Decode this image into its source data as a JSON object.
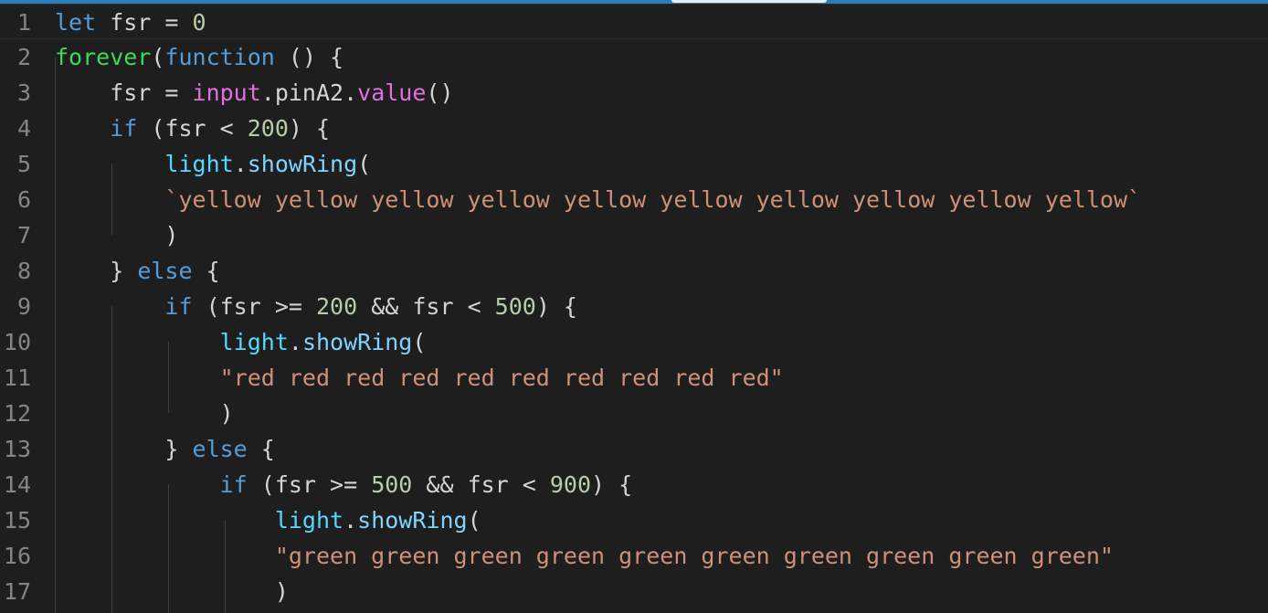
{
  "lines": [
    {
      "num": "1",
      "tokens": [
        {
          "t": "let",
          "c": "kw"
        },
        {
          "t": " fsr = ",
          "c": ""
        },
        {
          "t": "0",
          "c": "num"
        }
      ]
    },
    {
      "num": "2",
      "tokens": [
        {
          "t": "forever",
          "c": "green-fn"
        },
        {
          "t": "(",
          "c": ""
        },
        {
          "t": "function",
          "c": "kw"
        },
        {
          "t": " () {",
          "c": ""
        }
      ]
    },
    {
      "num": "3",
      "tokens": [
        {
          "t": "    fsr = ",
          "c": ""
        },
        {
          "t": "input",
          "c": "input-kw"
        },
        {
          "t": ".pinA2.",
          "c": ""
        },
        {
          "t": "value",
          "c": "input-kw"
        },
        {
          "t": "()",
          "c": ""
        }
      ]
    },
    {
      "num": "4",
      "tokens": [
        {
          "t": "    ",
          "c": ""
        },
        {
          "t": "if",
          "c": "kw"
        },
        {
          "t": " (fsr < ",
          "c": ""
        },
        {
          "t": "200",
          "c": "num"
        },
        {
          "t": ") {",
          "c": ""
        }
      ]
    },
    {
      "num": "5",
      "tokens": [
        {
          "t": "        ",
          "c": ""
        },
        {
          "t": "light",
          "c": "light-obj"
        },
        {
          "t": ".",
          "c": ""
        },
        {
          "t": "showRing",
          "c": "method"
        },
        {
          "t": "(",
          "c": ""
        }
      ]
    },
    {
      "num": "6",
      "tokens": [
        {
          "t": "        ",
          "c": ""
        },
        {
          "t": "`yellow yellow yellow yellow yellow yellow yellow yellow yellow yellow`",
          "c": "str"
        }
      ]
    },
    {
      "num": "7",
      "tokens": [
        {
          "t": "        )",
          "c": ""
        }
      ]
    },
    {
      "num": "8",
      "tokens": [
        {
          "t": "    } ",
          "c": ""
        },
        {
          "t": "else",
          "c": "kw"
        },
        {
          "t": " {",
          "c": ""
        }
      ]
    },
    {
      "num": "9",
      "tokens": [
        {
          "t": "        ",
          "c": ""
        },
        {
          "t": "if",
          "c": "kw"
        },
        {
          "t": " (fsr >= ",
          "c": ""
        },
        {
          "t": "200",
          "c": "num"
        },
        {
          "t": " && fsr < ",
          "c": ""
        },
        {
          "t": "500",
          "c": "num"
        },
        {
          "t": ") {",
          "c": ""
        }
      ]
    },
    {
      "num": "10",
      "tokens": [
        {
          "t": "            ",
          "c": ""
        },
        {
          "t": "light",
          "c": "light-obj"
        },
        {
          "t": ".",
          "c": ""
        },
        {
          "t": "showRing",
          "c": "method"
        },
        {
          "t": "(",
          "c": ""
        }
      ]
    },
    {
      "num": "11",
      "tokens": [
        {
          "t": "            ",
          "c": ""
        },
        {
          "t": "\"red red red red red red red red red red\"",
          "c": "str"
        }
      ]
    },
    {
      "num": "12",
      "tokens": [
        {
          "t": "            )",
          "c": ""
        }
      ]
    },
    {
      "num": "13",
      "tokens": [
        {
          "t": "        } ",
          "c": ""
        },
        {
          "t": "else",
          "c": "kw"
        },
        {
          "t": " {",
          "c": ""
        }
      ]
    },
    {
      "num": "14",
      "tokens": [
        {
          "t": "            ",
          "c": ""
        },
        {
          "t": "if",
          "c": "kw"
        },
        {
          "t": " (fsr >= ",
          "c": ""
        },
        {
          "t": "500",
          "c": "num"
        },
        {
          "t": " && fsr < ",
          "c": ""
        },
        {
          "t": "900",
          "c": "num"
        },
        {
          "t": ") {",
          "c": ""
        }
      ]
    },
    {
      "num": "15",
      "tokens": [
        {
          "t": "                ",
          "c": ""
        },
        {
          "t": "light",
          "c": "light-obj"
        },
        {
          "t": ".",
          "c": ""
        },
        {
          "t": "showRing",
          "c": "method"
        },
        {
          "t": "(",
          "c": ""
        }
      ]
    },
    {
      "num": "16",
      "tokens": [
        {
          "t": "                ",
          "c": ""
        },
        {
          "t": "\"green green green green green green green green green green\"",
          "c": "str"
        }
      ]
    },
    {
      "num": "17",
      "tokens": [
        {
          "t": "                )",
          "c": ""
        }
      ]
    }
  ],
  "colors": {
    "background": "#1e1e1e",
    "accent_bar": "#2b7fb8",
    "line_number": "#858585"
  }
}
